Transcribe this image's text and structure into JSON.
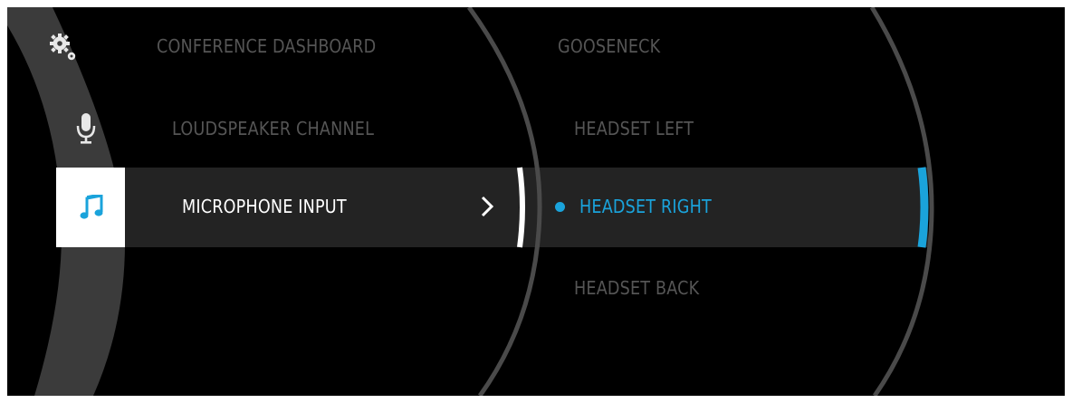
{
  "sidebar": {
    "items": [
      {
        "icon": "gears-icon",
        "state": "inactive"
      },
      {
        "icon": "microphone-icon",
        "state": "inactive"
      },
      {
        "icon": "music-note-icon",
        "state": "active"
      }
    ]
  },
  "menu": {
    "items": [
      {
        "label": "CONFERENCE DASHBOARD"
      },
      {
        "label": "LOUDSPEAKER CHANNEL"
      },
      {
        "label": "MICROPHONE INPUT",
        "state": "active"
      }
    ],
    "expand_icon": "chevron-right-icon"
  },
  "submenu": {
    "items": [
      {
        "label": "GOOSENECK"
      },
      {
        "label": "HEADSET LEFT"
      },
      {
        "label": "HEADSET RIGHT",
        "state": "selected"
      },
      {
        "label": "HEADSET BACK"
      }
    ],
    "selected_indicator": "dot-icon"
  },
  "colors": {
    "background": "#000000",
    "accent": "#1aa3db",
    "inactive_text": "#555555",
    "active_band": "#232323",
    "arc": "#4a4a4a"
  }
}
